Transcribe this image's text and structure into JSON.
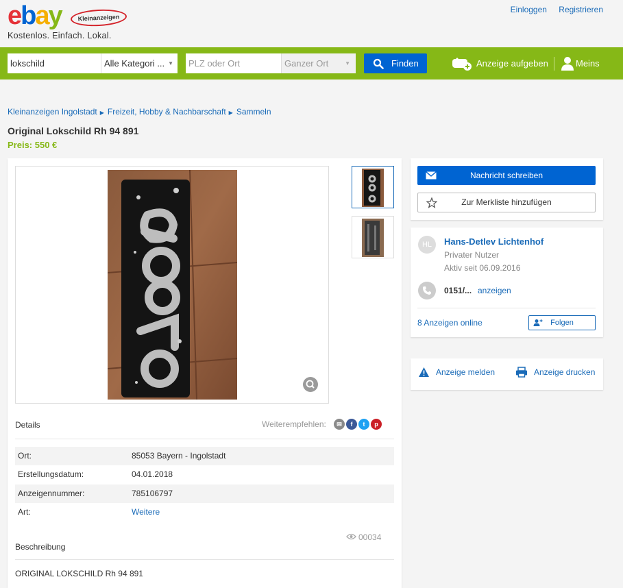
{
  "header": {
    "logo_text": "ebay",
    "logo_sub": "Kleinanzeigen",
    "tagline": "Kostenlos. Einfach. Lokal.",
    "login": "Einloggen",
    "register": "Registrieren"
  },
  "search": {
    "query": "lokschild",
    "category": "Alle Kategori ...",
    "location_placeholder": "PLZ oder Ort",
    "radius": "Ganzer Ort",
    "find_label": "Finden",
    "post_ad_label": "Anzeige aufgeben",
    "mine_label": "Meins"
  },
  "breadcrumb": [
    "Kleinanzeigen Ingolstadt",
    "Freizeit, Hobby & Nachbarschaft",
    "Sammeln"
  ],
  "listing": {
    "title": "Original Lokschild Rh 94 891",
    "price": "Preis: 550 €",
    "details_label": "Details",
    "share_label": "Weiterempfehlen:",
    "details": [
      {
        "key": "Ort:",
        "value": "85053 Bayern - Ingolstadt",
        "link": false
      },
      {
        "key": "Erstellungsdatum:",
        "value": "04.01.2018",
        "link": false
      },
      {
        "key": "Anzeigennummer:",
        "value": "785106797",
        "link": false
      },
      {
        "key": "Art:",
        "value": "Weitere",
        "link": true
      }
    ],
    "views": "00034",
    "description_label": "Beschreibung",
    "description": "ORIGINAL LOKSCHILD Rh 94 891"
  },
  "contact": {
    "message_label": "Nachricht schreiben",
    "watchlist_label": "Zur Merkliste hinzufügen"
  },
  "seller": {
    "initials": "HL",
    "name": "Hans-Detlev Lichtenhof",
    "type": "Privater Nutzer",
    "since": "Aktiv seit 06.09.2016",
    "phone": "0151/...",
    "phone_show": "anzeigen",
    "ads_online": "8 Anzeigen online",
    "follow_label": "Folgen"
  },
  "actions": {
    "report_label": "Anzeige melden",
    "print_label": "Anzeige drucken"
  },
  "colors": {
    "brand_green": "#86b817",
    "primary_blue": "#0064d2",
    "link_blue": "#1a6bb8"
  }
}
